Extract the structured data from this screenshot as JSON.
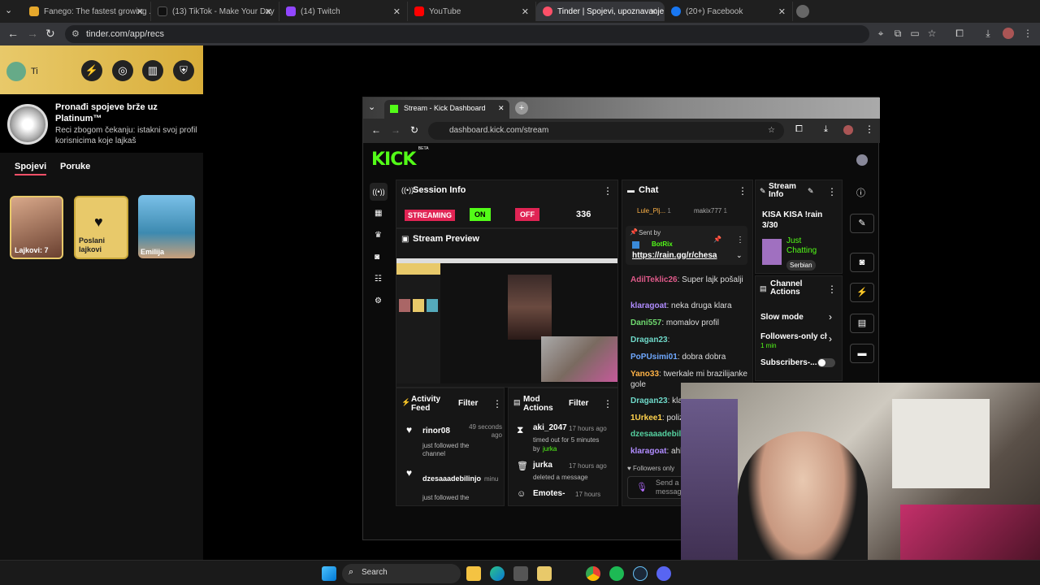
{
  "browser": {
    "tabs": [
      {
        "label": "Fanego: The fastest growing ..."
      },
      {
        "label": "(13) TikTok - Make Your Day"
      },
      {
        "label": "(14) Twitch"
      },
      {
        "label": "YouTube"
      },
      {
        "label": "Tinder | Spojevi, upoznavanje p"
      },
      {
        "label": "(20+) Facebook"
      }
    ],
    "url": "tinder.com/app/recs"
  },
  "tinder": {
    "ti_label": "Ti",
    "promo_title": "Pronađi spojeve brže uz Platinum™",
    "promo_sub": "Reci zbogom čekanju: istakni svoj profil korisnicima koje lajkaš",
    "nav_spojevi": "Spojevi",
    "nav_poruke": "Poruke",
    "card1": "Lajkovi: 7",
    "card2": "Poslani lajkovi",
    "card3": "Emilija"
  },
  "kick": {
    "tab_title": "Stream - Kick Dashboard",
    "url": "dashboard.kick.com/stream",
    "logo": "KICK",
    "logo_beta": "BETA",
    "session": {
      "title": "Session Info",
      "streaming": "STREAMING",
      "on": "ON",
      "off": "OFF",
      "viewers": "336"
    },
    "preview_title": "Stream Preview",
    "activity": {
      "title": "Activity Feed",
      "filter": "Filter",
      "items": [
        {
          "user": "rinor08",
          "time": "49 seconds ago",
          "action": "just followed the channel"
        },
        {
          "user": "dzesaaadebilinjo",
          "time": "minu",
          "action": "just followed the"
        }
      ]
    },
    "mod": {
      "title": "Mod Actions",
      "filter": "Filter",
      "items": [
        {
          "user": "aki_2047",
          "time": "17 hours ago",
          "action": "timed out for 5 minutes",
          "by_label": "by",
          "by": "jurka"
        },
        {
          "user": "jurka",
          "time": "17 hours ago",
          "action": "deleted a message"
        },
        {
          "user": "Emotes-",
          "time": "17 hours"
        }
      ]
    },
    "chat": {
      "title": "Chat",
      "pinned_users": [
        "Lule_Plj...",
        "makix777"
      ],
      "pinned_counts": [
        "1",
        "1"
      ],
      "sent_by": "Sent by",
      "bot": "BotRix",
      "bot_link": "https://rain.gg/r/chesa",
      "lines": [
        {
          "user": "AdilTeklic26",
          "msg": ": Super lajk pošalji",
          "color": "#e05a8a"
        },
        {
          "user": "klaragoat",
          "msg": ": neka druga klara",
          "color": "#b08cff"
        },
        {
          "user": "Dani557",
          "msg": ": momalov profil",
          "color": "#6fd96f"
        },
        {
          "user": "Dragan23",
          "msg": ":",
          "color": "#6fd9c9"
        },
        {
          "user": "PoPUsimi01",
          "msg": ": dobra dobra",
          "color": "#6fa8ff"
        },
        {
          "user": "Yano33",
          "msg": ": twerkale mi brazilijanke gole",
          "color": "#ffb347"
        },
        {
          "user": "Dragan23",
          "msg": ": klara",
          "color": "#6fd9c9"
        },
        {
          "user": "1Urkee1",
          "msg": ": polizes",
          "color": "#ffd24d"
        },
        {
          "user": "dzesaaadebilin",
          "msg": "",
          "color": "#55d0a0"
        },
        {
          "user": "klaragoat",
          "msg": ": ahha",
          "color": "#b08cff"
        }
      ],
      "followers_only": "Followers only",
      "send": "Send a messag"
    },
    "stream_info": {
      "title": "Stream Info",
      "name": "KISA KISA !rain 3/30",
      "category": "Just Chatting",
      "tag": "Serbian"
    },
    "channel_actions": {
      "title": "Channel Actions",
      "slow_mode": "Slow mode",
      "followers_only": "Followers-only ch",
      "followers_sub": "1 min",
      "subscribers": "Subscribers-..."
    }
  },
  "taskbar": {
    "search": "Search"
  }
}
